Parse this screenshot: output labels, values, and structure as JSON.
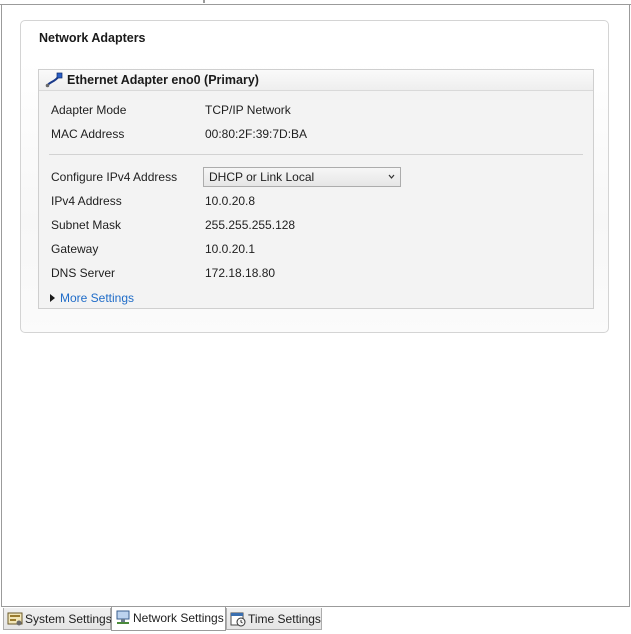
{
  "group": {
    "title": "Network Adapters"
  },
  "adapter": {
    "title": "Ethernet Adapter eno0 (Primary)",
    "icon": "network-cable-icon",
    "mode_label": "Adapter Mode",
    "mode_value": "TCP/IP Network",
    "mac_label": "MAC Address",
    "mac_value": "00:80:2F:39:7D:BA",
    "configure_label": "Configure IPv4 Address",
    "configure_value": "DHCP or Link Local",
    "ipv4_label": "IPv4 Address",
    "ipv4_value": "10.0.20.8",
    "subnet_label": "Subnet Mask",
    "subnet_value": "255.255.255.128",
    "gateway_label": "Gateway",
    "gateway_value": "10.0.20.1",
    "dns_label": "DNS Server",
    "dns_value": "172.18.18.80",
    "more_settings": "More Settings"
  },
  "tabs": [
    {
      "label": "System Settings",
      "icon": "system-settings-icon",
      "active": false
    },
    {
      "label": "Network Settings",
      "icon": "network-settings-icon",
      "active": true
    },
    {
      "label": "Time Settings",
      "icon": "time-settings-icon",
      "active": false
    }
  ],
  "colors": {
    "link": "#1f6cc8",
    "border": "#cfcfcf",
    "panel": "#f3f3f3"
  }
}
